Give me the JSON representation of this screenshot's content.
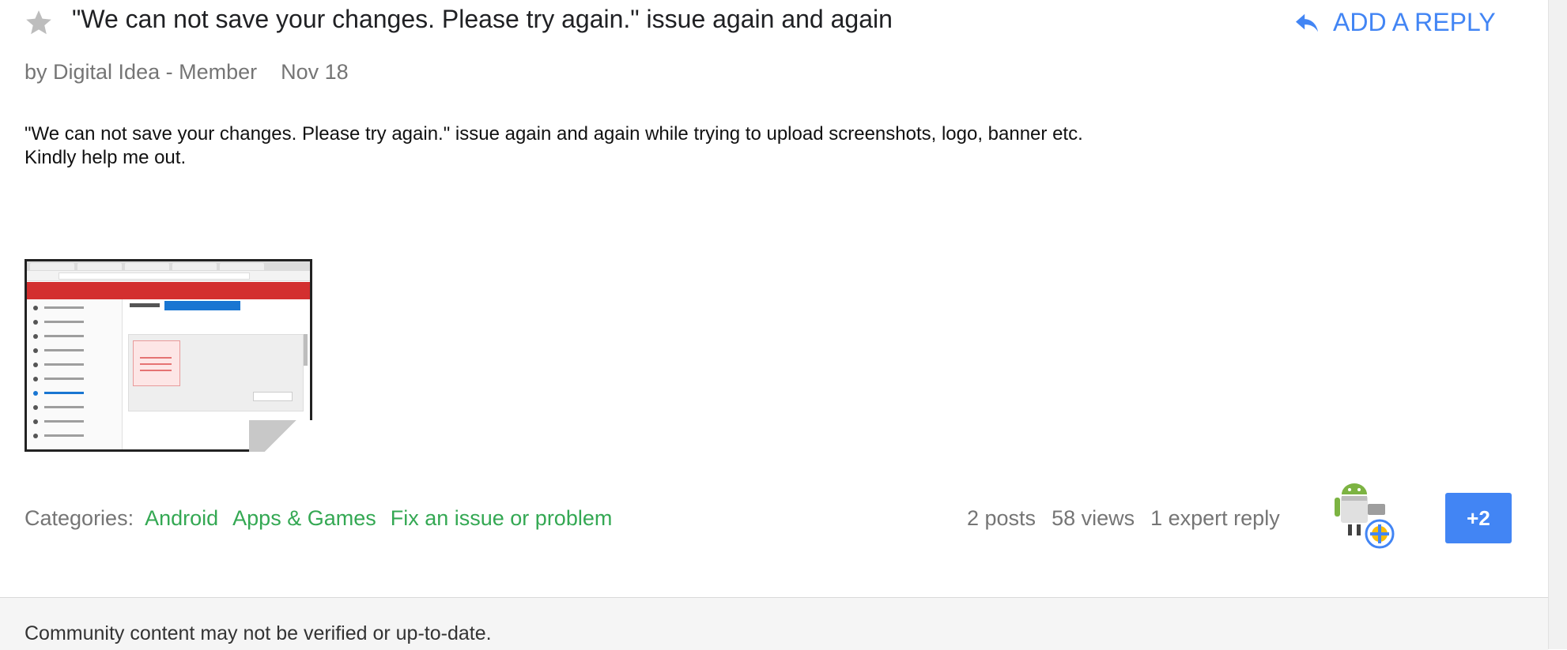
{
  "post": {
    "star_icon": "star-icon",
    "title": "\"We can not save your changes. Please try again.\" issue again and again",
    "reply_icon": "reply-arrow-icon",
    "reply_label": "ADD A REPLY",
    "author": "by Digital Idea - Member",
    "date": "Nov 18",
    "body_line1": "\"We can not save your changes. Please try again.\" issue again and again while trying to upload screenshots, logo, banner etc.",
    "body_line2": "Kindly help me out."
  },
  "categories": {
    "label": "Categories:",
    "items": [
      "Android",
      "Apps & Games",
      "Fix an issue or problem"
    ]
  },
  "stats": {
    "posts": "2 posts",
    "views": "58 views",
    "expert_replies": "1 expert reply"
  },
  "participants_more": "+2",
  "footer": {
    "notice": "Community content may not be verified or up-to-date."
  },
  "colors": {
    "accent_blue": "#4285f4",
    "category_green": "#34a853",
    "muted_text": "#757575",
    "footer_bg": "#f5f5f5"
  }
}
